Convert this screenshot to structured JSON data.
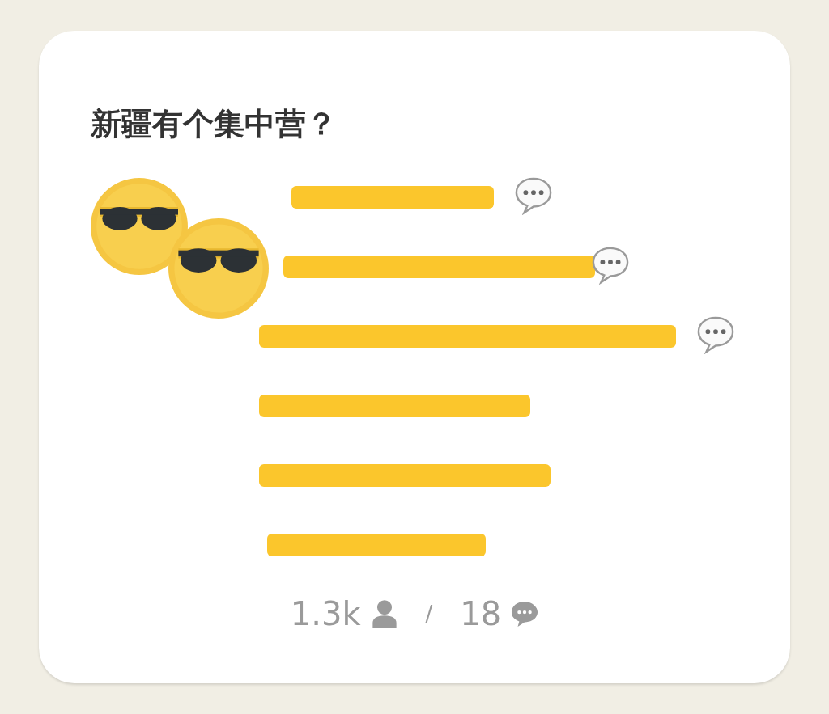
{
  "room": {
    "title": "新疆有个集中营？",
    "people": [
      {
        "kind": "speaker"
      },
      {
        "kind": "speaker"
      },
      {
        "kind": "speaker"
      },
      {
        "kind": "listener"
      },
      {
        "kind": "listener"
      },
      {
        "kind": "listener"
      }
    ],
    "stats": {
      "listeners": "1.3k",
      "separator": "/",
      "speakers": "18"
    }
  }
}
